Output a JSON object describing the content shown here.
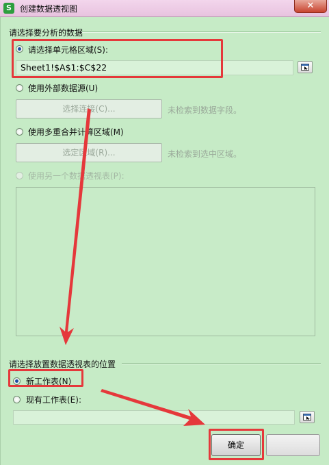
{
  "window": {
    "title": "创建数据透视图",
    "app_icon": "S",
    "close_glyph": "✕"
  },
  "source_group": {
    "title": "请选择要分析的数据",
    "option_range": {
      "label": "请选择单元格区域(S):",
      "value": "Sheet1!$A$1:$C$22",
      "selected": true
    },
    "option_external": {
      "label": "使用外部数据源(U)",
      "button": "选择连接(C)...",
      "hint": "未检索到数据字段。"
    },
    "option_consolidate": {
      "label": "使用多重合并计算区域(M)",
      "button": "选定区域(R)...",
      "hint": "未检索到选中区域。"
    },
    "option_other_pivot": {
      "label": "使用另一个数据透视表(P):"
    }
  },
  "placement_group": {
    "title": "请选择放置数据透视表的位置",
    "option_new_sheet": {
      "label": "新工作表(N)",
      "selected": true
    },
    "option_existing_sheet": {
      "label": "现有工作表(E):",
      "value": ""
    }
  },
  "footer": {
    "ok_label": "确定"
  },
  "annotation": {
    "color": "#e5383b"
  }
}
